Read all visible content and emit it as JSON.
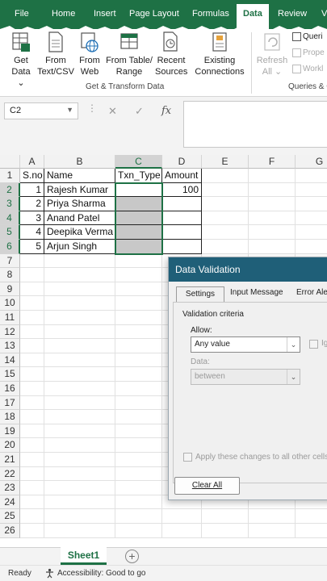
{
  "ribbon": {
    "tabs": [
      "File",
      "Home",
      "Insert",
      "Page Layout",
      "Formulas",
      "Data",
      "Review",
      "V"
    ],
    "active_tab": "Data",
    "get_data": {
      "line1": "Get",
      "line2": "Data"
    },
    "from_text": {
      "line1": "From",
      "line2": "Text/CSV"
    },
    "from_web": {
      "line1": "From",
      "line2": "Web"
    },
    "from_table": {
      "line1": "From Table/",
      "line2": "Range"
    },
    "recent_sources": {
      "line1": "Recent",
      "line2": "Sources"
    },
    "existing_connections": {
      "line1": "Existing",
      "line2": "Connections"
    },
    "refresh_all": {
      "line1": "Refresh",
      "line2": "All"
    },
    "group_get_transform": "Get & Transform Data",
    "group_queries": "Queries & C",
    "queries_items": [
      "Queri",
      "Prope",
      "Workl"
    ]
  },
  "formula_bar": {
    "name_box": "C2",
    "fx": "fx",
    "cancel": "✕",
    "enter": "✓",
    "content": ""
  },
  "grid": {
    "columns": [
      "A",
      "B",
      "C",
      "D",
      "E",
      "F",
      "G"
    ],
    "selected_column": "C",
    "rows": [
      "1",
      "2",
      "3",
      "4",
      "5",
      "6",
      "7",
      "8",
      "9",
      "10",
      "11",
      "12",
      "13",
      "14",
      "15",
      "16",
      "17",
      "18",
      "19",
      "20",
      "21",
      "22",
      "23",
      "24",
      "25",
      "26"
    ],
    "header_row": {
      "A": "S.no",
      "B": "Name",
      "C": "Txn_Type",
      "D": "Amount"
    },
    "data_rows": [
      {
        "A": "1",
        "B": "Rajesh Kumar",
        "C": "",
        "D": "100"
      },
      {
        "A": "2",
        "B": "Priya Sharma",
        "C": "",
        "D": ""
      },
      {
        "A": "3",
        "B": "Anand Patel",
        "C": "",
        "D": ""
      },
      {
        "A": "4",
        "B": "Deepika Verma",
        "C": "",
        "D": ""
      },
      {
        "A": "5",
        "B": "Arjun Singh",
        "C": "",
        "D": ""
      }
    ]
  },
  "sheets": {
    "active": "Sheet1",
    "add_label": "+"
  },
  "status": {
    "ready": "Ready",
    "accessibility": "Accessibility: Good to go"
  },
  "dialog": {
    "title": "Data Validation",
    "tabs": [
      "Settings",
      "Input Message",
      "Error Ale"
    ],
    "active_tab": "Settings",
    "section": "Validation criteria",
    "allow_label": "Allow:",
    "allow_value": "Any value",
    "ignore_blank": "Ig",
    "data_label": "Data:",
    "data_value": "between",
    "apply_all": "Apply these changes to all other cells w",
    "clear_all": "Clear All"
  },
  "colors": {
    "excel_green": "#1e7145",
    "dialog_title": "#1f5f78",
    "fill_grey": "#c8c8c8"
  }
}
